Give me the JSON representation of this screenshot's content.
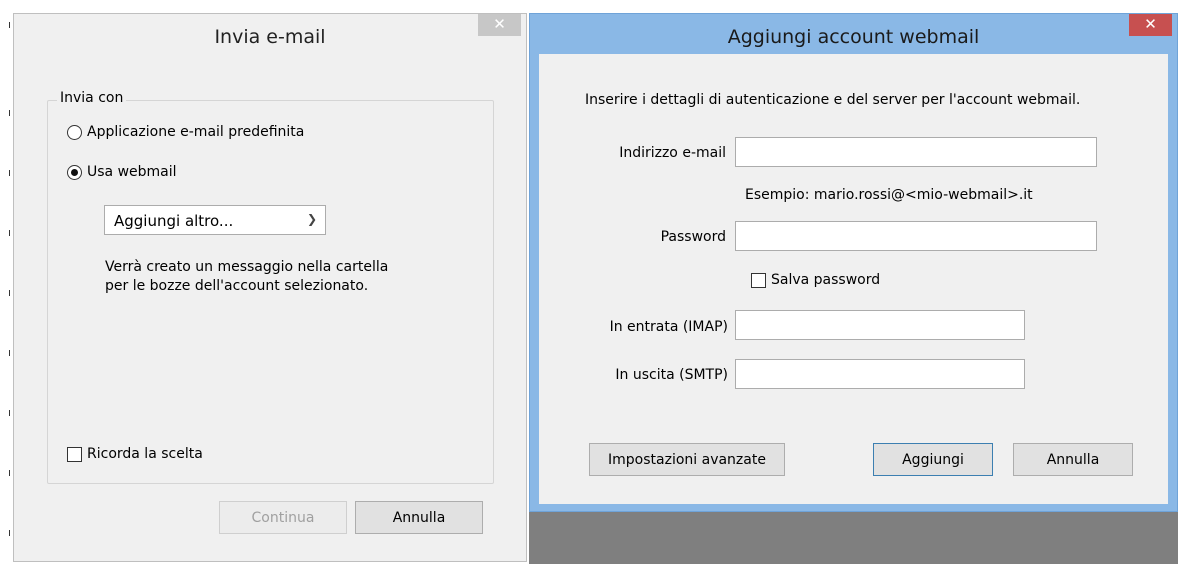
{
  "send_dialog": {
    "title": "Invia e-mail",
    "close_glyph": "✕",
    "group_label": "Invia con",
    "options": [
      {
        "label": "Applicazione e-mail predefinita",
        "selected": false
      },
      {
        "label": "Usa webmail",
        "selected": true
      }
    ],
    "account_select": {
      "value": "Aggiungi altro..."
    },
    "info_line1": "Verrà creato un messaggio nella cartella",
    "info_line2": "per le bozze dell'account selezionato.",
    "remember_label": "Ricorda la scelta",
    "remember_checked": false,
    "continue_label": "Continua",
    "cancel_label": "Annulla"
  },
  "webmail_dialog": {
    "title": "Aggiungi account webmail",
    "close_glyph": "✕",
    "instructions": "Inserire i dettagli di autenticazione e del server per l'account webmail.",
    "email_label": "Indirizzo e-mail",
    "email_value": "",
    "example_text": "Esempio: mario.rossi@<mio-webmail>.it",
    "password_label": "Password",
    "password_value": "",
    "save_password_label": "Salva password",
    "save_password_checked": false,
    "imap_label": "In entrata (IMAP)",
    "imap_value": "",
    "smtp_label": "In uscita (SMTP)",
    "smtp_value": "",
    "advanced_label": "Impostazioni avanzate",
    "add_label": "Aggiungi",
    "cancel_label": "Annulla"
  },
  "colors": {
    "dialog_bg": "#f0f0f0",
    "active_frame": "#8ab8e6",
    "close_active": "#c75050",
    "close_inactive": "#c7c7c7"
  }
}
